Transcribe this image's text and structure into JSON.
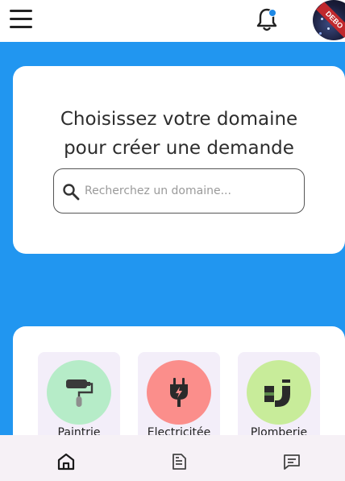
{
  "header": {
    "menu_icon": "hamburger-menu-icon",
    "notification_icon": "bell-icon",
    "notification_badge_color": "#1e88e5",
    "avatar_text": "DEBO"
  },
  "hero": {
    "title_line1": "Choisissez votre domaine",
    "title_line2": "pour créer une demande",
    "search": {
      "placeholder": "Recherchez un domaine...",
      "value": "",
      "icon": "search-icon"
    }
  },
  "domains": [
    {
      "label": "Paintrie",
      "icon": "paint-roller-icon",
      "color": "#b6ecc8"
    },
    {
      "label": "Electricitée",
      "icon": "power-plug-icon",
      "color": "#fb8e8b"
    },
    {
      "label": "Plomberie",
      "icon": "pipe-icon",
      "color": "#c8ec9a"
    }
  ],
  "bottom_nav": [
    {
      "name": "home",
      "icon": "home-icon",
      "active": true
    },
    {
      "name": "requests",
      "icon": "document-icon",
      "active": false
    },
    {
      "name": "messages",
      "icon": "chat-icon",
      "active": false
    }
  ],
  "colors": {
    "background": "#2196f0",
    "card": "#ffffff",
    "tile": "#f3eef9",
    "nav": "#f6f1f6"
  }
}
